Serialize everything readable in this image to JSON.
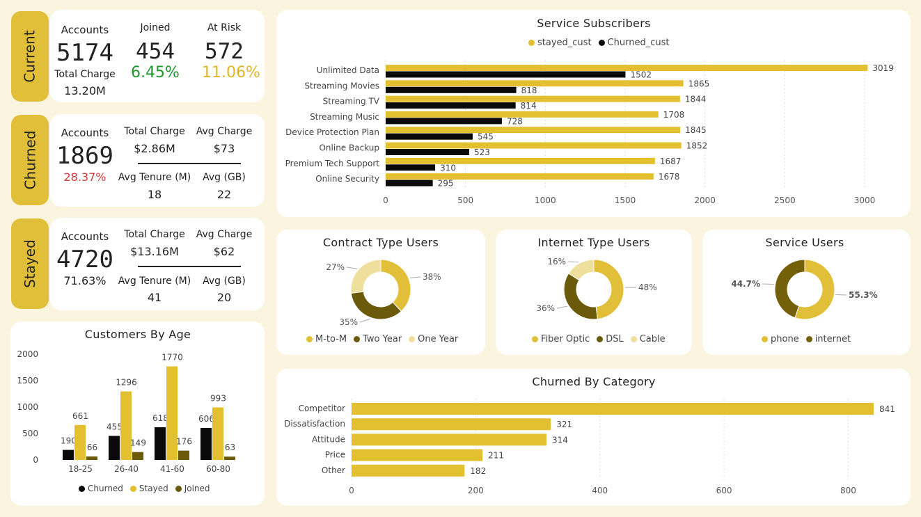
{
  "colors": {
    "gold": "#e1bf38",
    "bar_gold": "#e3c02f",
    "black": "#0a0a0a",
    "olive": "#6b5a0a",
    "dark_olive": "#75600a",
    "light_gold": "#efdf9c",
    "green": "#1a9a2a",
    "orange": "#e1b52a",
    "red": "#d03a3a"
  },
  "current": {
    "tab": "Current",
    "accounts_label": "Accounts",
    "accounts": "5174",
    "total_charge_label": "Total Charge",
    "total_charge": "13.20M",
    "joined_label": "Joined",
    "joined": "454",
    "joined_pct": "6.45%",
    "at_risk_label": "At Risk",
    "at_risk": "572",
    "at_risk_pct": "11.06%"
  },
  "churned": {
    "tab": "Churned",
    "accounts_label": "Accounts",
    "accounts": "1869",
    "pct": "28.37%",
    "total_charge_label": "Total Charge",
    "total_charge": "$2.86M",
    "avg_charge_label": "Avg Charge",
    "avg_charge": "$73",
    "avg_tenure_label": "Avg Tenure (M)",
    "avg_tenure": "18",
    "avg_gb_label": "Avg (GB)",
    "avg_gb": "22"
  },
  "stayed": {
    "tab": "Stayed",
    "accounts_label": "Accounts",
    "accounts": "4720",
    "pct": "71.63%",
    "total_charge_label": "Total Charge",
    "total_charge": "$13.16M",
    "avg_charge_label": "Avg Charge",
    "avg_charge": "$62",
    "avg_tenure_label": "Avg Tenure (M)",
    "avg_tenure": "41",
    "avg_gb_label": "Avg (GB)",
    "avg_gb": "20"
  },
  "chart_data": [
    {
      "id": "service_subscribers",
      "type": "bar",
      "orientation": "horizontal",
      "title": "Service Subscribers",
      "categories": [
        "Unlimited Data",
        "Streaming Movies",
        "Streaming TV",
        "Streaming Music",
        "Device Protection Plan",
        "Online Backup",
        "Premium Tech Support",
        "Online Security"
      ],
      "series": [
        {
          "name": "stayed_cust",
          "values": [
            3019,
            1865,
            1844,
            1708,
            1845,
            1852,
            1687,
            1678
          ]
        },
        {
          "name": "Churned_cust",
          "values": [
            1502,
            818,
            814,
            728,
            545,
            523,
            310,
            295
          ]
        }
      ],
      "xlim": [
        0,
        3000
      ],
      "xticks": [
        0,
        500,
        1000,
        1500,
        2000,
        2500,
        3000
      ],
      "legend": "top-center",
      "grid": true
    },
    {
      "id": "contract_type",
      "type": "pie",
      "donut": true,
      "title": "Contract Type Users",
      "labels": [
        "M-to-M",
        "Two Year",
        "One Year"
      ],
      "values": [
        38,
        35,
        27
      ],
      "value_labels": [
        "38%",
        "35%",
        "27%"
      ],
      "legend": "bottom"
    },
    {
      "id": "internet_type",
      "type": "pie",
      "donut": true,
      "title": "Internet Type Users",
      "labels": [
        "Fiber Optic",
        "DSL",
        "Cable"
      ],
      "values": [
        48,
        36,
        16
      ],
      "value_labels": [
        "48%",
        "36%",
        "16%"
      ],
      "legend": "bottom"
    },
    {
      "id": "service_users",
      "type": "pie",
      "donut": true,
      "title": "Service Users",
      "labels": [
        "phone",
        "internet"
      ],
      "values": [
        55.3,
        44.7
      ],
      "value_labels": [
        "55.3%",
        "44.7%"
      ],
      "legend": "bottom"
    },
    {
      "id": "customers_by_age",
      "type": "bar",
      "title": "Customers By Age",
      "categories": [
        "18-25",
        "26-40",
        "41-60",
        "60-80"
      ],
      "series": [
        {
          "name": "Churned",
          "values": [
            190,
            455,
            618,
            606
          ]
        },
        {
          "name": "Stayed",
          "values": [
            661,
            1296,
            1770,
            993
          ]
        },
        {
          "name": "Joined",
          "values": [
            66,
            149,
            176,
            63
          ]
        }
      ],
      "ylim": [
        0,
        2000
      ],
      "yticks": [
        0,
        500,
        1000,
        1500,
        2000
      ],
      "legend": "bottom"
    },
    {
      "id": "churned_by_category",
      "type": "bar",
      "orientation": "horizontal",
      "title": "Churned By Category",
      "categories": [
        "Competitor",
        "Dissatisfaction",
        "Attitude",
        "Price",
        "Other"
      ],
      "values": [
        841,
        321,
        314,
        211,
        182
      ],
      "xlim": [
        0,
        850
      ],
      "xticks": [
        0,
        200,
        400,
        600,
        800
      ],
      "grid": true
    }
  ]
}
